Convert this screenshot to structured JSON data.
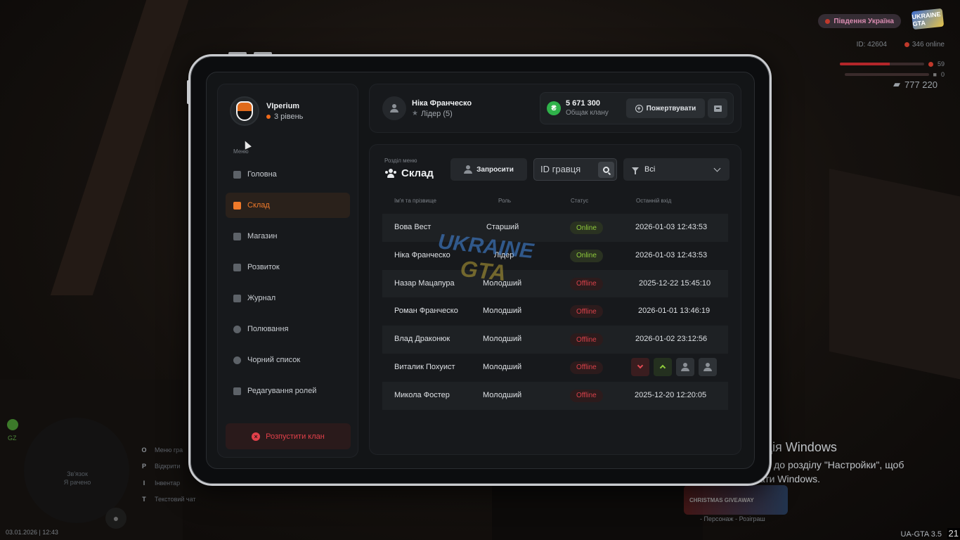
{
  "hud": {
    "server": "Південня Україна",
    "logo_text": "UKRAINE GTA",
    "id": "ID: 42604",
    "online": "346 online",
    "health": "59",
    "health_pct": 0.59,
    "armor": "0",
    "money": "777 220",
    "gz": "GZ",
    "radar_text_1": "Зв'язок",
    "radar_text_2": "Я рачено",
    "keys": [
      {
        "key": "O",
        "label": "Меню гра"
      },
      {
        "key": "P",
        "label": "Відкрити"
      },
      {
        "key": "I",
        "label": "Інвентар"
      },
      {
        "key": "T",
        "label": "Текстовий чат"
      }
    ],
    "datetime": "03.01.2026 | 12:43",
    "version": "UA-GTA 3.5",
    "version_num": "21",
    "xmas_banner": "CHRISTMAS GIVEAWAY",
    "xmas_sub": "- Персонаж - Розіграш"
  },
  "windows_activation": {
    "title": "Активація Windows",
    "text": "Перейдіть до розділу \"Настройки\", щоб активувати Windows."
  },
  "profile": {
    "name": "VIperium",
    "level": "3 рівень"
  },
  "menu_label": "Меню",
  "nav": [
    {
      "label": "Головна",
      "icon": "home-icon"
    },
    {
      "label": "Склад",
      "icon": "group-icon",
      "active": true
    },
    {
      "label": "Магазин",
      "icon": "basket-icon"
    },
    {
      "label": "Розвиток",
      "icon": "chart-icon"
    },
    {
      "label": "Журнал",
      "icon": "book-icon"
    },
    {
      "label": "Полювання",
      "icon": "target-icon"
    },
    {
      "label": "Чорний список",
      "icon": "ban-icon"
    },
    {
      "label": "Редагування ролей",
      "icon": "user-edit-icon"
    }
  ],
  "dissolve_label": "Розпустити клан",
  "leader": {
    "name": "Ніка Франческо",
    "role": "Лідер (5)"
  },
  "bank": {
    "currency_symbol": "₴",
    "value": "5 671 300",
    "label": "Общак клану",
    "donate_label": "Пожертвувати"
  },
  "section": {
    "sub": "Розділ меню",
    "title": "Склад",
    "invite_label": "Запросити",
    "search_placeholder": "ID гравця",
    "filter_value": "Всі"
  },
  "table": {
    "headers": [
      "Ім'я та прізвище",
      "Роль",
      "Статус",
      "Останній вхід"
    ],
    "rows": [
      {
        "name": "Вова Вест",
        "role": "Старший",
        "status": "Online",
        "last": "2026-01-03 12:43:53"
      },
      {
        "name": "Ніка Франческо",
        "role": "Лідер",
        "status": "Online",
        "last": "2026-01-03 12:43:53"
      },
      {
        "name": "Назар Мацапура",
        "role": "Молодший",
        "status": "Offline",
        "last": "2025-12-22 15:45:10"
      },
      {
        "name": "Роман Франческо",
        "role": "Молодший",
        "status": "Offline",
        "last": "2026-01-01 13:46:19"
      },
      {
        "name": "Влад Драконюк",
        "role": "Молодший",
        "status": "Offline",
        "last": "2026-01-02 23:12:56"
      },
      {
        "name": "Виталик Похуист",
        "role": "Молодший",
        "status": "Offline",
        "last": ""
      },
      {
        "name": "Микола Фостер",
        "role": "Молодший",
        "status": "Offline",
        "last": "2025-12-20 12:20:05"
      }
    ]
  },
  "watermark": {
    "line1": "UKRAINE",
    "line2": "GTA"
  },
  "colors": {
    "accent": "#f07a2a",
    "online": "#8fcb3b",
    "offline": "#d9414a",
    "coin": "#2fb24a"
  }
}
